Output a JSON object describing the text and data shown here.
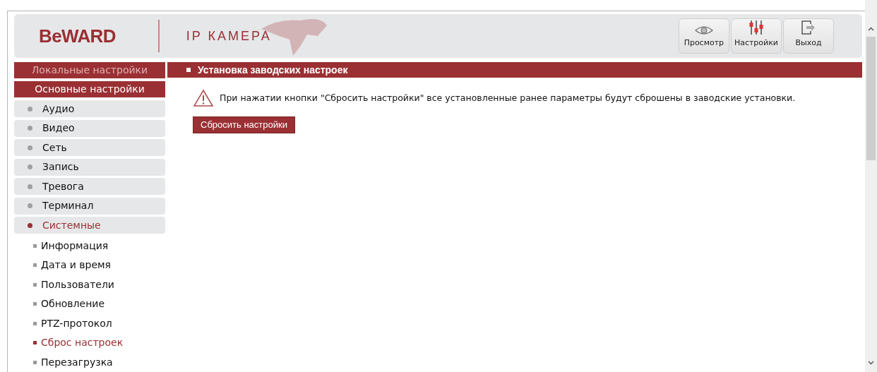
{
  "header": {
    "logo": "BeWARD",
    "product": "IP КАМЕРА",
    "buttons": [
      {
        "kind": "view",
        "label": "Просмотр"
      },
      {
        "kind": "settings",
        "label": "Настройки"
      },
      {
        "kind": "exit",
        "label": "Выход"
      }
    ]
  },
  "sidebar": {
    "tabs": [
      {
        "label": "Локальные настройки",
        "selected": false
      },
      {
        "label": "Основные настройки",
        "selected": true
      }
    ],
    "items": [
      {
        "label": "Аудио",
        "selected": false
      },
      {
        "label": "Видео",
        "selected": false
      },
      {
        "label": "Сеть",
        "selected": false
      },
      {
        "label": "Запись",
        "selected": false
      },
      {
        "label": "Тревога",
        "selected": false
      },
      {
        "label": "Терминал",
        "selected": false
      },
      {
        "label": "Системные",
        "selected": true,
        "children": [
          {
            "label": "Информация",
            "selected": false
          },
          {
            "label": "Дата и время",
            "selected": false
          },
          {
            "label": "Пользователи",
            "selected": false
          },
          {
            "label": "Обновление",
            "selected": false
          },
          {
            "label": "PTZ-протокол",
            "selected": false
          },
          {
            "label": "Сброс настроек",
            "selected": true
          },
          {
            "label": "Перезагрузка",
            "selected": false
          }
        ]
      }
    ]
  },
  "content": {
    "title": "Установка заводских настроек",
    "warning": "При нажатии кнопки \"Сбросить настройки\" все установленные ранее параметры будут сброшены в заводские установки.",
    "button": "Сбросить настройки"
  }
}
